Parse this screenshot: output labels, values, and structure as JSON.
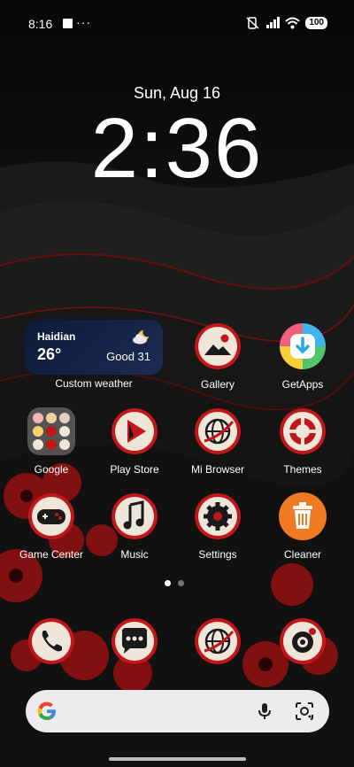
{
  "status_bar": {
    "time": "8:16",
    "more": "···",
    "battery": "100"
  },
  "lock": {
    "date": "Sun, Aug 16",
    "time": "2:36"
  },
  "weather": {
    "city": "Haidian",
    "temp": "26°",
    "aqi": "Good 31",
    "label": "Custom weather",
    "icon": "partly-cloudy-night-icon"
  },
  "apps": [
    {
      "label": "Gallery",
      "icon": "gallery-icon"
    },
    {
      "label": "GetApps",
      "icon": "getapps-icon"
    },
    {
      "label": "Google",
      "icon": "google-folder-icon"
    },
    {
      "label": "Play Store",
      "icon": "play-store-icon"
    },
    {
      "label": "Mi Browser",
      "icon": "browser-icon"
    },
    {
      "label": "Themes",
      "icon": "themes-icon"
    },
    {
      "label": "Game Center",
      "icon": "gamepad-icon"
    },
    {
      "label": "Music",
      "icon": "music-note-icon"
    },
    {
      "label": "Settings",
      "icon": "gear-icon"
    },
    {
      "label": "Cleaner",
      "icon": "trash-icon"
    }
  ],
  "dock": [
    {
      "icon": "phone-icon"
    },
    {
      "icon": "messages-icon"
    },
    {
      "icon": "browser-icon"
    },
    {
      "icon": "camera-icon"
    }
  ],
  "pages": {
    "count": 2,
    "active": 1
  },
  "colors": {
    "accent_red": "#c0171a",
    "icon_cream": "#efe6da",
    "cleaner_orange": "#f07a22",
    "widget_blue": "#17244a"
  }
}
